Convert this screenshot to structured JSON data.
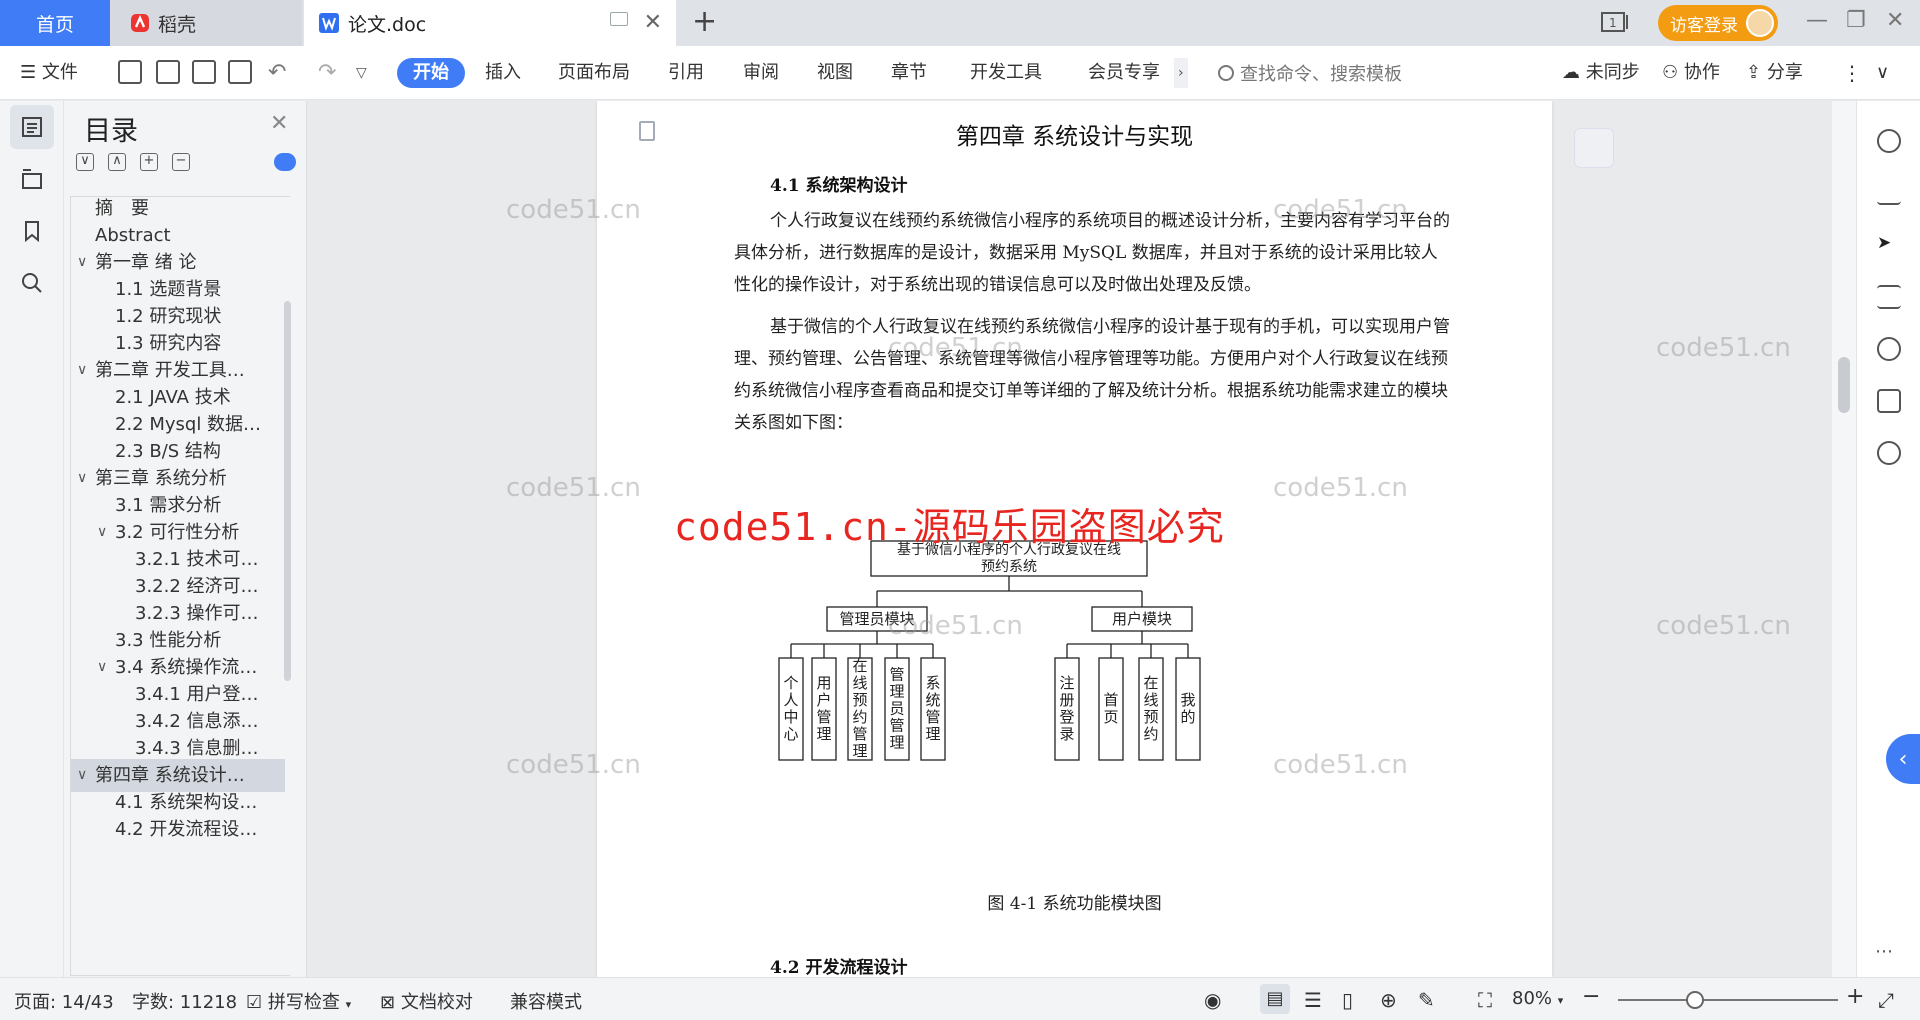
{
  "tabs": {
    "home": "首页",
    "daoke": "稻壳",
    "doc": "论文.doc",
    "visitor": "访客登录"
  },
  "ribbon": {
    "file": "文件",
    "items": [
      "开始",
      "插入",
      "页面布局",
      "引用",
      "审阅",
      "视图",
      "章节",
      "开发工具",
      "会员专享"
    ],
    "search_placeholder": "查找命令、搜索模板",
    "unsync": "未同步",
    "collab": "协作",
    "share": "分享"
  },
  "toc": {
    "title": "目录",
    "items": [
      {
        "label": "摘　要",
        "level": 1,
        "arrow": ""
      },
      {
        "label": "Abstract",
        "level": 1,
        "arrow": ""
      },
      {
        "label": "第一章 绪 论",
        "level": 1,
        "arrow": "∨"
      },
      {
        "label": "1.1 选题背景",
        "level": 2,
        "arrow": ""
      },
      {
        "label": "1.2 研究现状",
        "level": 2,
        "arrow": ""
      },
      {
        "label": "1.3 研究内容",
        "level": 2,
        "arrow": ""
      },
      {
        "label": "第二章 开发工具…",
        "level": 1,
        "arrow": "∨"
      },
      {
        "label": "2.1 JAVA 技术",
        "level": 2,
        "arrow": ""
      },
      {
        "label": "2.2 Mysql 数据…",
        "level": 2,
        "arrow": ""
      },
      {
        "label": "2.3 B/S 结构",
        "level": 2,
        "arrow": ""
      },
      {
        "label": "第三章 系统分析",
        "level": 1,
        "arrow": "∨"
      },
      {
        "label": "3.1 需求分析",
        "level": 2,
        "arrow": ""
      },
      {
        "label": "3.2 可行性分析",
        "level": 2,
        "arrow": "∨"
      },
      {
        "label": "3.2.1 技术可…",
        "level": 3,
        "arrow": ""
      },
      {
        "label": "3.2.2 经济可…",
        "level": 3,
        "arrow": ""
      },
      {
        "label": "3.2.3 操作可…",
        "level": 3,
        "arrow": ""
      },
      {
        "label": "3.3 性能分析",
        "level": 2,
        "arrow": ""
      },
      {
        "label": "3.4 系统操作流…",
        "level": 2,
        "arrow": "∨"
      },
      {
        "label": "3.4.1 用户登…",
        "level": 3,
        "arrow": ""
      },
      {
        "label": "3.4.2 信息添…",
        "level": 3,
        "arrow": ""
      },
      {
        "label": "3.4.3 信息删…",
        "level": 3,
        "arrow": ""
      },
      {
        "label": "第四章 系统设计…",
        "level": 1,
        "arrow": "∨",
        "selected": true
      },
      {
        "label": "4.1 系统架构设…",
        "level": 2,
        "arrow": ""
      },
      {
        "label": "4.2 开发流程设…",
        "level": 2,
        "arrow": ""
      }
    ]
  },
  "doc": {
    "chapter_title": "第四章 系统设计与实现",
    "section1": "4.1 系统架构设计",
    "para1": "个人行政复议在线预约系统微信小程序的系统项目的概述设计分析，主要内容有学习平台的具体分析，进行数据库的是设计，数据采用 MySQL 数据库，并且对于系统的设计采用比较人性化的操作设计，对于系统出现的错误信息可以及时做出处理及反馈。",
    "para2": "基于微信的个人行政复议在线预约系统微信小程序的设计基于现有的手机，可以实现用户管理、预约管理、公告管理、系统管理等微信小程序管理等功能。方便用户对个人行政复议在线预约系统微信小程序查看商品和提交订单等详细的了解及统计分析。根据系统功能需求建立的模块关系图如下图：",
    "steal_notice": "code51.cn-源码乐园盗图必究",
    "figure_caption": "图 4-1  系统功能模块图",
    "section2": "4.2 开发流程设计",
    "watermark": "code51.cn"
  },
  "diagram": {
    "root": "基于微信小程序的个人行政复议在线预约系统",
    "admin": "管理员模块",
    "user": "用户模块",
    "admin_children": [
      "个人中心",
      "用户管理",
      "在线预约管理",
      "管理员管理",
      "系统管理"
    ],
    "user_children": [
      "注册登录",
      "首页",
      "在线预约",
      "我的"
    ]
  },
  "status": {
    "page": "页面: 14/43",
    "words": "字数: 11218",
    "spell": "拼写检查",
    "proof": "文档校对",
    "compat": "兼容模式",
    "zoom": "80%"
  },
  "colors": {
    "accent": "#3f7cf6",
    "visitor": "#f39c12",
    "steal_red": "#e8251f"
  }
}
